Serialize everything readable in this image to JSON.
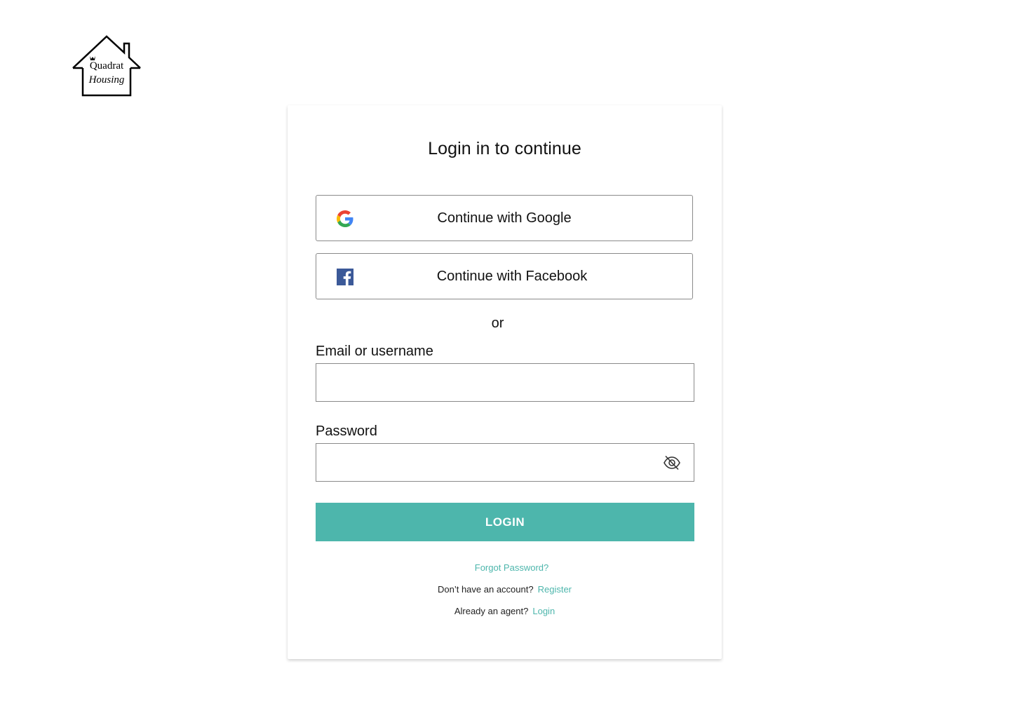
{
  "brand": {
    "logo_line1": "Quadrat",
    "logo_line2": "Housing"
  },
  "login": {
    "title": "Login in to continue",
    "google_label": "Continue with Google",
    "facebook_label": "Continue with Facebook",
    "or_text": "or",
    "email_label": "Email or username",
    "email_value": "",
    "email_placeholder": "",
    "password_label": "Password",
    "password_value": "",
    "password_placeholder": "",
    "submit_label": "LOGIN",
    "forgot_label": "Forgot Password?",
    "register_prompt": "Don’t have an account?",
    "register_link": "Register",
    "agent_prompt": "Already an agent?",
    "agent_link": "Login"
  },
  "icons": {
    "google": "google-icon",
    "facebook": "facebook-icon",
    "password_toggle": "eye-off-icon"
  },
  "colors": {
    "accent": "#4db6ac",
    "facebook_blue": "#3b5998",
    "border": "#8a8a8a"
  }
}
